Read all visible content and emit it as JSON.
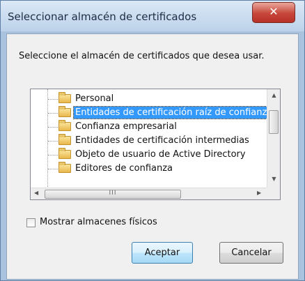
{
  "dialog": {
    "title": "Seleccionar almacén de certificados",
    "close_glyph": "✕",
    "instruction": "Seleccione el almacén de certificados que desea usar."
  },
  "tree": {
    "items": [
      {
        "label": "Personal",
        "selected": false
      },
      {
        "label": "Entidades de certificación raíz de confianza",
        "selected": true
      },
      {
        "label": "Confianza empresarial",
        "selected": false
      },
      {
        "label": "Entidades de certificación intermedias",
        "selected": false
      },
      {
        "label": "Objeto de usuario de Active Directory",
        "selected": false
      },
      {
        "label": "Editores de confianza",
        "selected": false
      }
    ],
    "scroll_up_glyph": "▲",
    "scroll_down_glyph": "▼",
    "scroll_left_glyph": "◀",
    "scroll_right_glyph": "▶",
    "hthumb_grip": "III"
  },
  "options": {
    "show_physical_label": "Mostrar almacenes físicos",
    "show_physical_checked": false
  },
  "buttons": {
    "ok_label": "Aceptar",
    "cancel_label": "Cancelar"
  },
  "colors": {
    "selection": "#3399ff",
    "close_button": "#c7463a",
    "titlebar": "#bcd2ea"
  }
}
